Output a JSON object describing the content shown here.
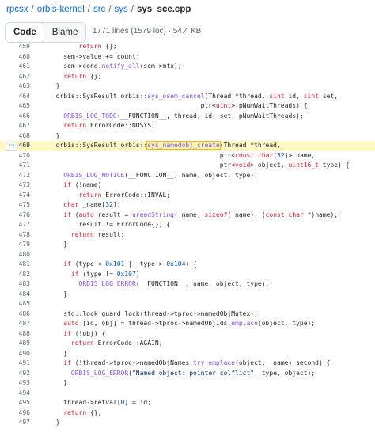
{
  "breadcrumb": [
    {
      "label": "rpcsx",
      "link": true
    },
    {
      "label": "orbis-kernel",
      "link": true
    },
    {
      "label": "src",
      "link": true
    },
    {
      "label": "sys",
      "link": true
    },
    {
      "label": "sys_sce.cpp",
      "link": false
    }
  ],
  "toolbar": {
    "code_label": "Code",
    "blame_label": "Blame",
    "file_meta": "1771 lines (1579 loc) · 54.4 KB"
  },
  "more_icon": "ellipsis-icon",
  "highlight_line": "469",
  "colors": {
    "link": "#0969da",
    "keyword": "#cf222e",
    "function": "#8250df",
    "number": "#0550ae",
    "string": "#0a3069",
    "highlight": "#fff8c5"
  },
  "code_lines": [
    {
      "n": "459",
      "t": "        return {};"
    },
    {
      "n": "460",
      "t": "    sem->value += count;"
    },
    {
      "n": "461",
      "t": "    sem->cond.notify_all(sem->mtx);"
    },
    {
      "n": "462",
      "t": "    return {};"
    },
    {
      "n": "463",
      "t": "  }"
    },
    {
      "n": "464",
      "t": "  orbis::SysResult orbis::sys_osem_cancel(Thread *thread, sint id, sint set,"
    },
    {
      "n": "465",
      "t": "                                        ptr<uint> pNumWaitThreads) {"
    },
    {
      "n": "466",
      "t": "    ORBIS_LOG_TODO(__FUNCTION__, thread, id, set, pNumWaitThreads);"
    },
    {
      "n": "467",
      "t": "    return ErrorCode::NOSYS;"
    },
    {
      "n": "468",
      "t": "  }"
    },
    {
      "n": "469",
      "t": "  orbis::SysResult orbis::sys_namedobj_create(Thread *thread,"
    },
    {
      "n": "470",
      "t": "                                             ptr<const char[32]> name,"
    },
    {
      "n": "471",
      "t": "                                             ptr<void> object, uint16_t type) {"
    },
    {
      "n": "472",
      "t": "    ORBIS_LOG_NOTICE(__FUNCTION__, name, object, type);"
    },
    {
      "n": "473",
      "t": "    if (!name)"
    },
    {
      "n": "474",
      "t": "        return ErrorCode::INVAL;"
    },
    {
      "n": "475",
      "t": "    char _name[32];"
    },
    {
      "n": "476",
      "t": "    if (auto result = ureadString(_name, sizeof(_name), (const char *)name);"
    },
    {
      "n": "477",
      "t": "        result != ErrorCode{}) {"
    },
    {
      "n": "478",
      "t": "      return result;"
    },
    {
      "n": "479",
      "t": "    }"
    },
    {
      "n": "480",
      "t": ""
    },
    {
      "n": "481",
      "t": "    if (type < 0x101 || type > 0x104) {"
    },
    {
      "n": "482",
      "t": "      if (type != 0x107)"
    },
    {
      "n": "483",
      "t": "        ORBIS_LOG_ERROR(__FUNCTION__, name, object, type);"
    },
    {
      "n": "484",
      "t": "    }"
    },
    {
      "n": "485",
      "t": ""
    },
    {
      "n": "486",
      "t": "    std::lock_guard lock(thread->tproc->namedObjMutex);"
    },
    {
      "n": "487",
      "t": "    auto [id, obj] = thread->tproc->namedObjIds.emplace(object, type);"
    },
    {
      "n": "488",
      "t": "    if (!obj) {"
    },
    {
      "n": "489",
      "t": "      return ErrorCode::AGAIN;"
    },
    {
      "n": "490",
      "t": "    }"
    },
    {
      "n": "491",
      "t": "    if (!thread->tproc->namedObjNames.try_emplace(object, _name).second) {"
    },
    {
      "n": "492",
      "t": "      ORBIS_LOG_ERROR(\"Named object: pointer colflict\", type, object);"
    },
    {
      "n": "493",
      "t": "    }"
    },
    {
      "n": "494",
      "t": ""
    },
    {
      "n": "495",
      "t": "    thread->retval[0] = id;"
    },
    {
      "n": "496",
      "t": "    return {};"
    },
    {
      "n": "497",
      "t": "  }"
    }
  ]
}
